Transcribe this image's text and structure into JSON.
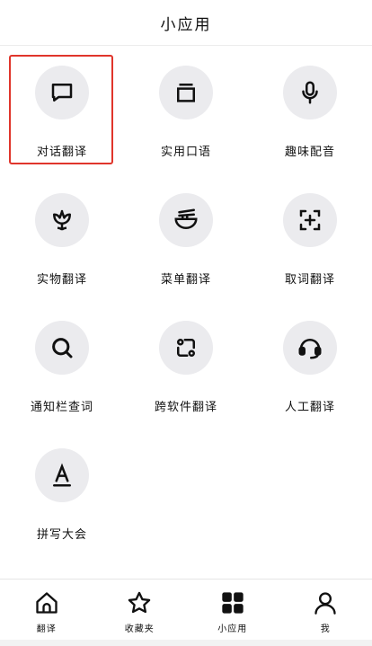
{
  "header": {
    "title": "小应用"
  },
  "tiles": [
    {
      "label": "对话翻译",
      "icon": "chat-bubble-icon"
    },
    {
      "label": "实用口语",
      "icon": "card-stack-icon"
    },
    {
      "label": "趣味配音",
      "icon": "microphone-icon"
    },
    {
      "label": "实物翻译",
      "icon": "flower-icon"
    },
    {
      "label": "菜单翻译",
      "icon": "noodle-bowl-icon"
    },
    {
      "label": "取词翻译",
      "icon": "scan-plus-icon"
    },
    {
      "label": "通知栏查词",
      "icon": "search-icon"
    },
    {
      "label": "跨软件翻译",
      "icon": "cross-app-icon"
    },
    {
      "label": "人工翻译",
      "icon": "headset-icon"
    },
    {
      "label": "拼写大会",
      "icon": "letter-a-icon"
    }
  ],
  "bottom_nav": [
    {
      "label": "翻译",
      "icon": "home-icon"
    },
    {
      "label": "收藏夹",
      "icon": "star-icon"
    },
    {
      "label": "小应用",
      "icon": "grid-icon",
      "active": true
    },
    {
      "label": "我",
      "icon": "person-icon"
    }
  ],
  "colors": {
    "highlight": "#e0352b",
    "tile_bg": "#ebebee",
    "icon": "#111111"
  }
}
